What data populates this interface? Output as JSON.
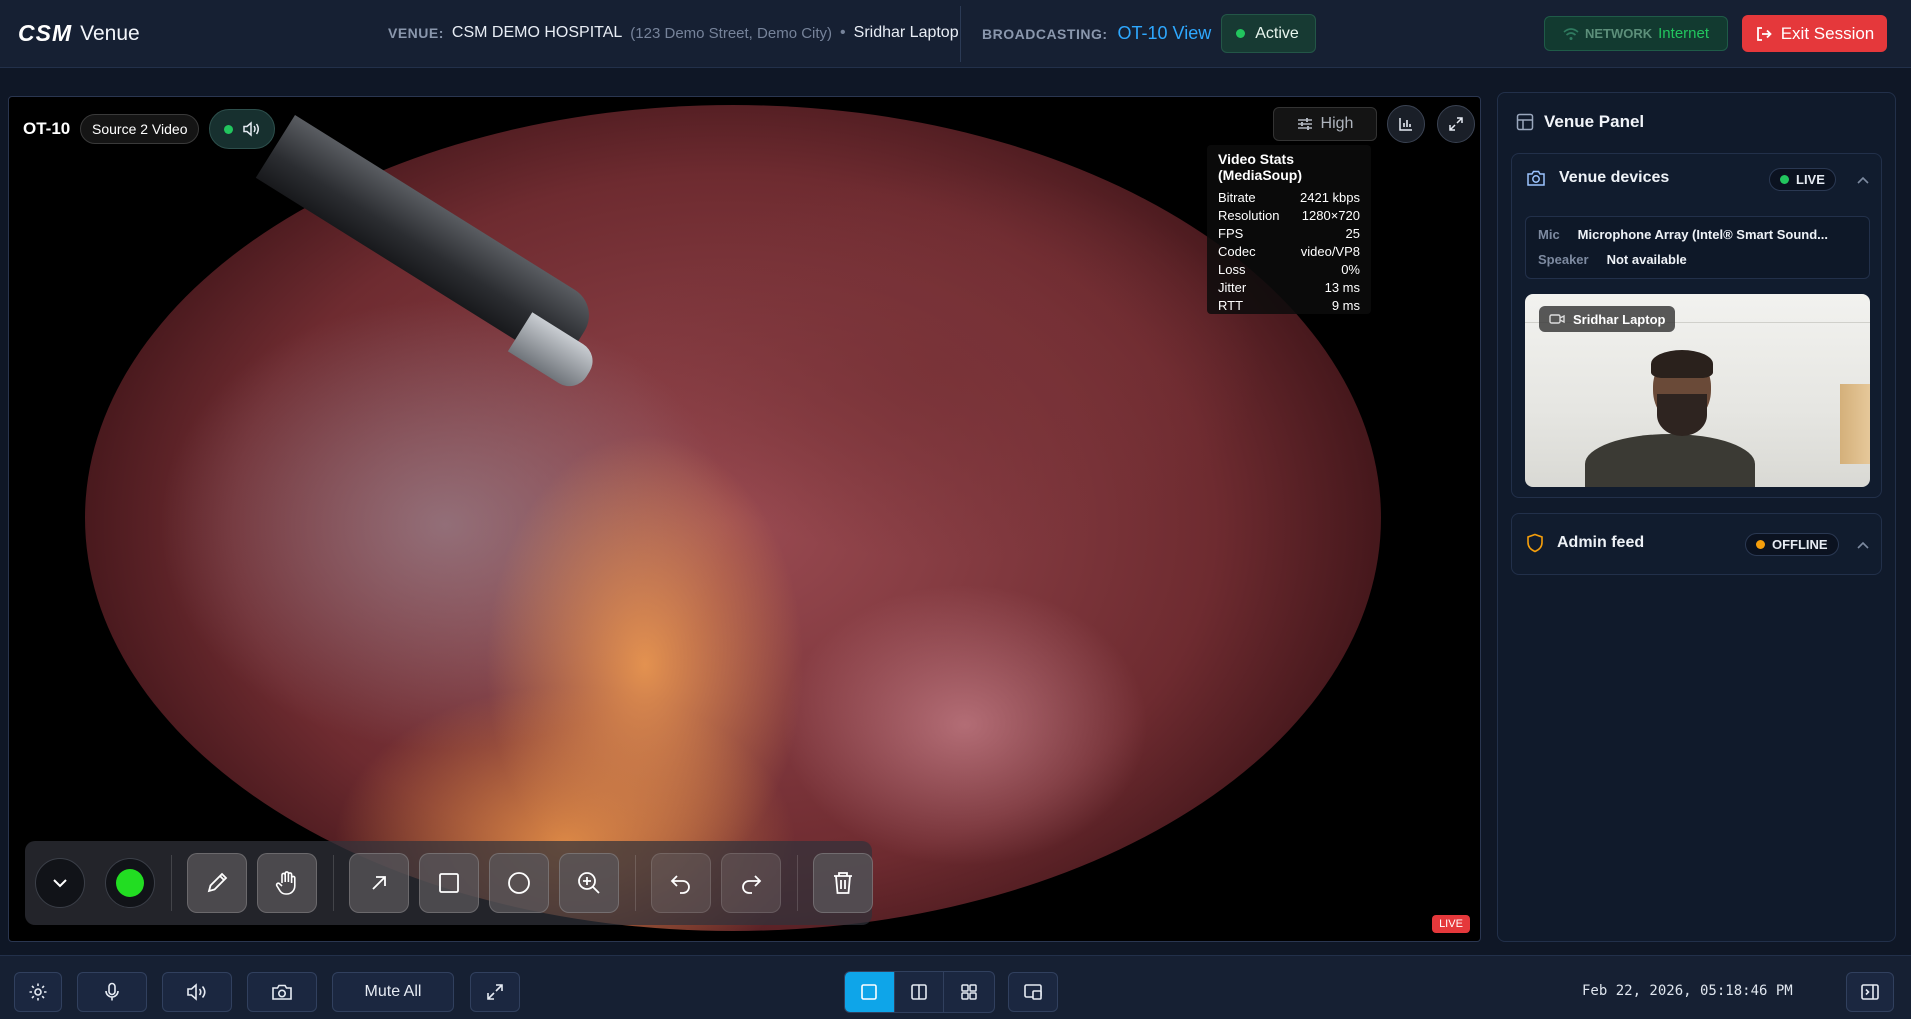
{
  "header": {
    "logo_mark": "CSM",
    "logo_text": "Venue",
    "venue_label": "VENUE:",
    "venue_name": "CSM DEMO HOSPITAL",
    "venue_address": "(123 Demo Street, Demo City)",
    "separator": "•",
    "device_name": "Sridhar Laptop",
    "broadcasting_label": "BROADCASTING:",
    "broadcasting_view": "OT-10 View",
    "active_label": "Active",
    "network_label": "NETWORK",
    "network_value": "Internet",
    "exit_label": "Exit Session"
  },
  "video": {
    "source_id": "OT-10",
    "source_name": "Source 2 Video",
    "quality": "High",
    "live_label": "LIVE",
    "stats_title": "Video Stats (MediaSoup)",
    "stats": [
      {
        "label": "Bitrate",
        "value": "2421 kbps"
      },
      {
        "label": "Resolution",
        "value": "1280×720"
      },
      {
        "label": "FPS",
        "value": "25"
      },
      {
        "label": "Codec",
        "value": "video/VP8"
      },
      {
        "label": "Loss",
        "value": "0%"
      },
      {
        "label": "Jitter",
        "value": "13 ms"
      },
      {
        "label": "RTT",
        "value": "9 ms"
      }
    ]
  },
  "annotation": {
    "current_color": "#22dd22",
    "tools": [
      "chevron-down-icon",
      "color-picker",
      "pencil-icon",
      "hand-icon",
      "arrow-icon",
      "rectangle-icon",
      "circle-icon",
      "zoom-in-icon",
      "undo-icon",
      "redo-icon",
      "trash-icon"
    ]
  },
  "panel": {
    "title": "Venue Panel",
    "venue_devices": {
      "title": "Venue devices",
      "status": "LIVE",
      "status_color": "#22c55e",
      "mic_label": "Mic",
      "mic_value": "Microphone Array (Intel® Smart Sound...",
      "speaker_label": "Speaker",
      "speaker_value": "Not available",
      "camera_label": "Sridhar Laptop"
    },
    "admin_feed": {
      "title": "Admin feed",
      "status": "OFFLINE",
      "status_color": "#f59e0b"
    }
  },
  "bottom": {
    "mute_all_label": "Mute All",
    "datetime": "Feb 22, 2026, 05:18:46 PM"
  },
  "colors": {
    "accent": "#2ea8ff",
    "danger": "#e5383b",
    "success": "#22c55e",
    "layout_active": "#0ea5e9"
  }
}
